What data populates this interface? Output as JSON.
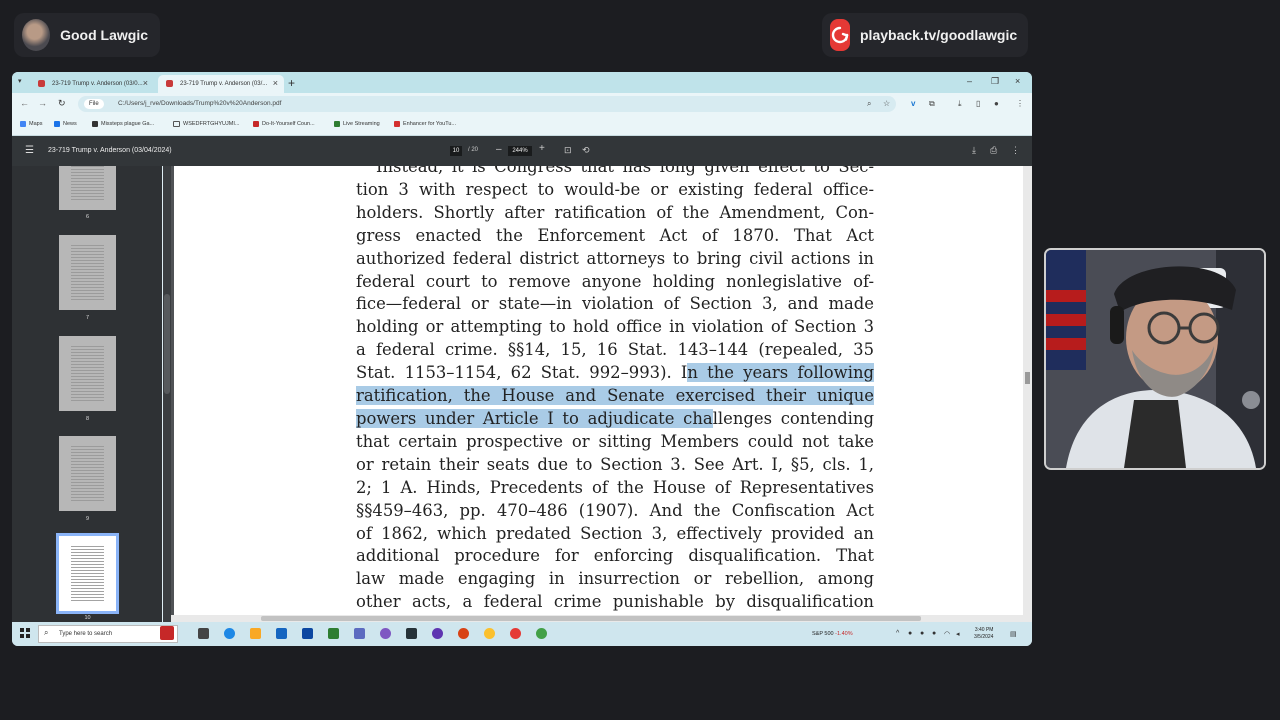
{
  "stream": {
    "channel_name": "Good Lawgic",
    "playback_url": "playback.tv/goodlawgic"
  },
  "browser": {
    "tabs": [
      {
        "label": "23-719 Trump v. Anderson (03/0..."
      },
      {
        "label": "23-719 Trump v. Anderson (03/..."
      }
    ],
    "url_chip": "File",
    "url": "C:/Users/j_rve/Downloads/Trump%20v%20Anderson.pdf",
    "bookmarks": [
      {
        "label": "Maps",
        "color": "#4285f4"
      },
      {
        "label": "News",
        "color": "#1a73e8"
      },
      {
        "label": "Missteps plague Ga...",
        "color": "#333333"
      },
      {
        "label": "WSEDFRTGHYUJMI...",
        "color": "#555555"
      },
      {
        "label": "Do-It-Yourself Coun...",
        "color": "#c62828"
      },
      {
        "label": "Live Streaming",
        "color": "#2e7d32"
      },
      {
        "label": "Enhancer for YouTu...",
        "color": "#d32f2f"
      }
    ]
  },
  "pdf": {
    "title": "23-719 Trump v. Anderson (03/04/2024)",
    "current_page": "10",
    "page_count": "/ 20",
    "zoom": "244%",
    "thumbnails": [
      "6",
      "7",
      "8",
      "9",
      "10"
    ],
    "active_thumbnail": "10",
    "lines": [
      "Instead, it is Congress that has long given effect to Sec-",
      "tion 3 with respect to would-be or existing federal office-",
      "holders.  Shortly after ratification of the Amendment, Con-",
      "gress enacted the Enforcement Act of 1870.  That Act",
      "authorized federal district attorneys to bring civil actions in",
      "federal court to remove anyone holding nonlegislative of-",
      "fice—federal or state—in violation of Section 3, and made",
      "holding or attempting to hold office in violation of Section 3",
      "a federal crime.  §§14, 15, 16 Stat. 143–144 (repealed, 35",
      "Stat. 1153–1154, 62 Stat. 992–993).  I",
      "n the years following",
      "ratification, the House and Senate exercised their unique",
      "powers under Article I to adjudicate cha",
      "llenges contending",
      "that certain prospective or sitting Members could not take",
      "or retain their seats due to Section 3.  See Art. I, §5, cls. 1,",
      "2; 1 A. Hinds, Precedents of the House of Representatives",
      "§§459–463, pp. 470–486 (1907).  And the Confiscation Act",
      "of 1862, which predated Section 3, effectively provided an",
      "additional procedure for enforcing disqualification.  That",
      "law made engaging in insurrection or rebellion, among",
      "other acts, a federal crime punishable by disqualification"
    ]
  },
  "taskbar": {
    "search_placeholder": "Type here to search",
    "ticker_name": "S&P 500",
    "ticker_change": "-1.40%",
    "time": "3:40 PM",
    "date": "3/5/2024"
  }
}
